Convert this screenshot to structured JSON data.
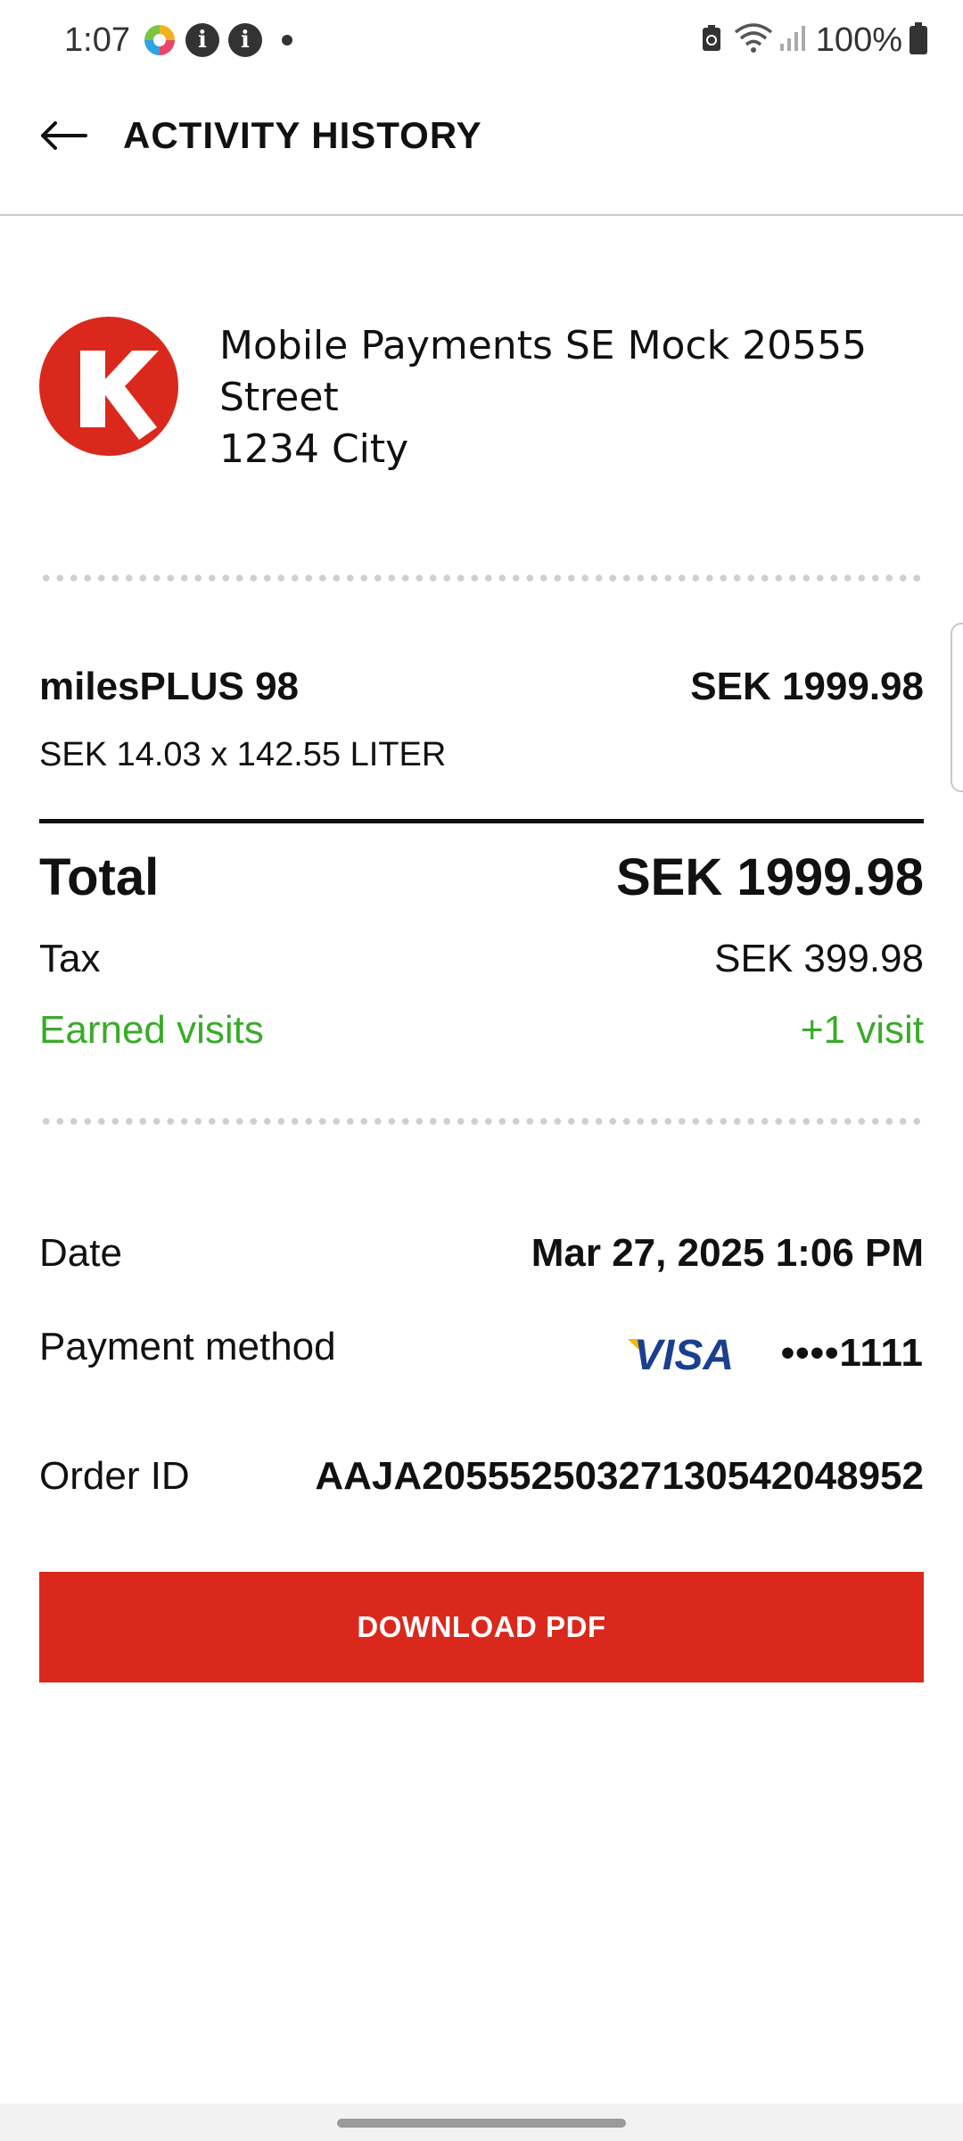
{
  "status_bar": {
    "time": "1:07",
    "battery": "100%",
    "icons": [
      "multicolor-app-icon",
      "info-icon",
      "info-icon",
      "dot-icon",
      "battery-saver-icon",
      "wifi-icon",
      "signal-icon",
      "battery-icon"
    ]
  },
  "header": {
    "title": "ACTIVITY HISTORY",
    "back_icon": "back-arrow-icon"
  },
  "merchant": {
    "logo_letter": "K",
    "logo_color": "#da291c",
    "address_line1": "Mobile Payments SE Mock 20555",
    "address_line2": "Street",
    "address_line3": "1234 City"
  },
  "item": {
    "name": "milesPLUS 98",
    "price": "SEK 1999.98",
    "detail": "SEK 14.03 x 142.55 LITER"
  },
  "summary": {
    "total_label": "Total",
    "total_value": "SEK 1999.98",
    "tax_label": "Tax",
    "tax_value": "SEK 399.98",
    "visits_label": "Earned visits",
    "visits_value": "+1 visit",
    "visits_color": "#3aaa2a"
  },
  "info": {
    "date_label": "Date",
    "date_value": "Mar 27, 2025 1:06 PM",
    "payment_label": "Payment method",
    "card_brand": "VISA",
    "card_number": "••••1111",
    "order_label": "Order ID",
    "order_value": "AAJA20555250327130542048952"
  },
  "actions": {
    "download_label": "DOWNLOAD PDF",
    "download_color": "#da291c"
  }
}
